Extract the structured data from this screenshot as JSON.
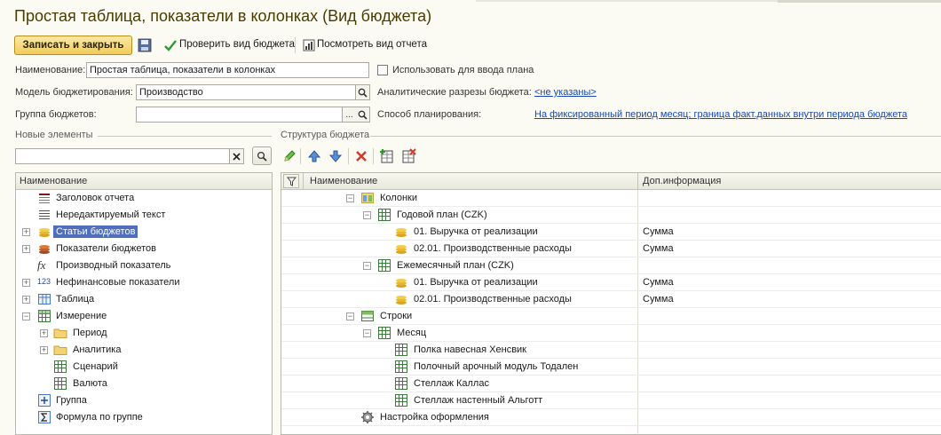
{
  "window": {
    "title": "Простая таблица, показатели в колонках (Вид бюджета)"
  },
  "toolbar": {
    "save_close": "Записать и закрыть",
    "check": "Проверить вид бюджета",
    "view_report": "Посмотреть вид отчета"
  },
  "form": {
    "name_label": "Наименование:",
    "name_value": "Простая таблица, показатели в колонках",
    "use_for_plan": "Использовать для ввода плана",
    "model_label": "Модель бюджетирования:",
    "model_value": "Производство",
    "analytics_label": "Аналитические разрезы бюджета:",
    "analytics_link": "<не указаны>",
    "group_label": "Группа бюджетов:",
    "group_value": "",
    "method_label": "Способ планирования:",
    "method_link": "На фиксированный период месяц;  граница факт.данных внутри периода бюджета"
  },
  "left": {
    "group_title": "Новые элементы",
    "search_value": "",
    "col_header": "Наименование",
    "items": [
      {
        "label": "Заголовок отчета"
      },
      {
        "label": "Нередактируемый текст"
      },
      {
        "label": "Статьи бюджетов"
      },
      {
        "label": "Показатели бюджетов"
      },
      {
        "label": "Производный показатель"
      },
      {
        "label": "Нефинансовые показатели"
      },
      {
        "label": "Таблица"
      },
      {
        "label": "Измерение"
      },
      {
        "label": "Период"
      },
      {
        "label": "Аналитика"
      },
      {
        "label": "Сценарий"
      },
      {
        "label": "Валюта"
      },
      {
        "label": "Группа"
      },
      {
        "label": "Формула по группе"
      }
    ]
  },
  "right": {
    "group_title": "Структура бюджета",
    "col_name": "Наименование",
    "col_info": "Доп.информация",
    "rows": [
      {
        "label": "Колонки",
        "info": ""
      },
      {
        "label": "Годовой план (CZK)",
        "info": ""
      },
      {
        "label": "01. Выручка от реализации",
        "info": "Сумма"
      },
      {
        "label": "02.01. Производственные расходы",
        "info": "Сумма"
      },
      {
        "label": "Ежемесячный план (CZK)",
        "info": ""
      },
      {
        "label": "01. Выручка от реализации",
        "info": "Сумма"
      },
      {
        "label": "02.01. Производственные расходы",
        "info": "Сумма"
      },
      {
        "label": "Строки",
        "info": ""
      },
      {
        "label": "Месяц",
        "info": ""
      },
      {
        "label": "Полка навесная Хенсвик",
        "info": ""
      },
      {
        "label": "Полочный арочный модуль Тодален",
        "info": ""
      },
      {
        "label": "Стеллаж Каллас",
        "info": ""
      },
      {
        "label": "Стеллаж настенный Альготт",
        "info": ""
      },
      {
        "label": "Настройка оформления",
        "info": ""
      }
    ]
  }
}
